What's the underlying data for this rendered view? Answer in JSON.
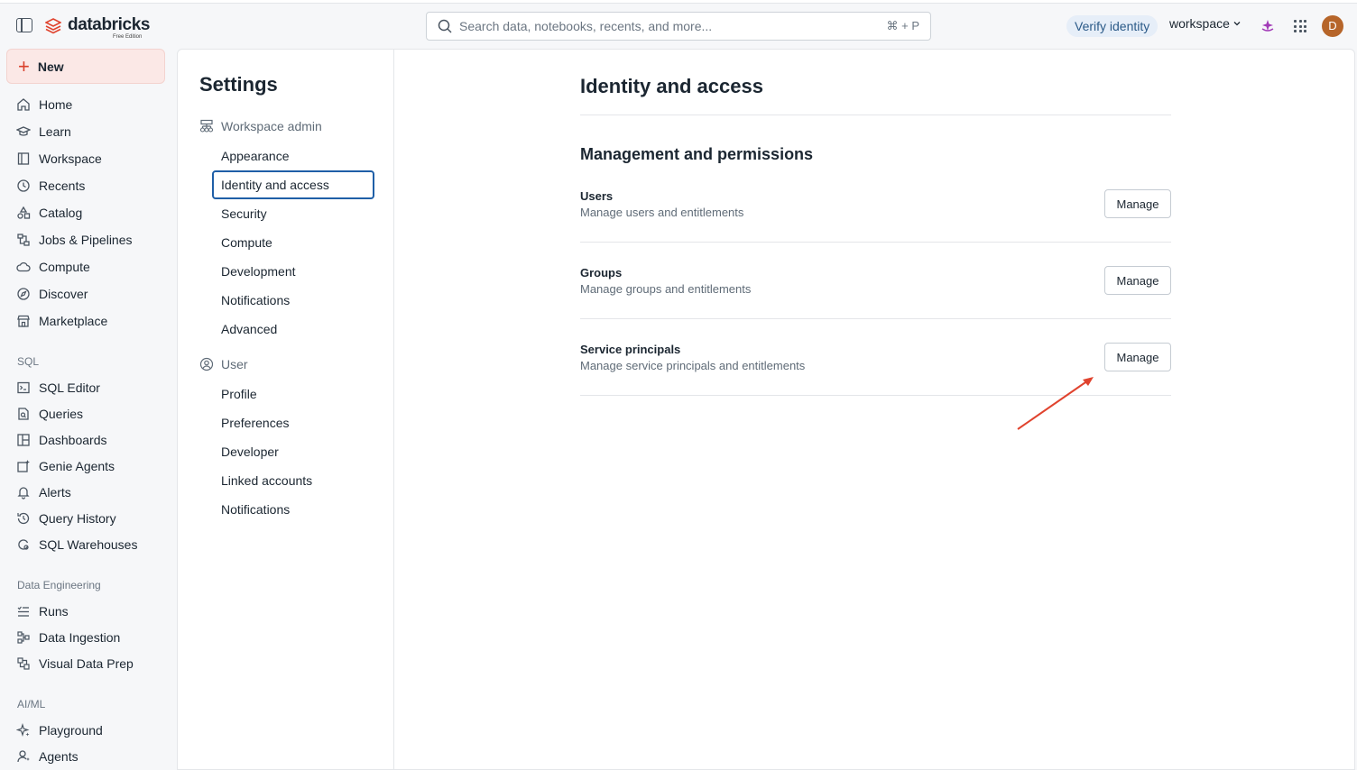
{
  "brand": {
    "name": "databricks",
    "edition": "Free Edition"
  },
  "search": {
    "placeholder": "Search data, notebooks, recents, and more...",
    "shortcut": "⌘ + P"
  },
  "header": {
    "verify_label": "Verify identity",
    "workspace_label": "workspace",
    "avatar_initial": "D"
  },
  "colors": {
    "accent": "#d9402b",
    "active_border": "#1f5fa7",
    "annotation_arrow": "#e0432e"
  },
  "sidebar": {
    "new_label": "New",
    "items": [
      {
        "label": "Home",
        "icon": "home-icon"
      },
      {
        "label": "Learn",
        "icon": "graduation-cap-icon"
      },
      {
        "label": "Workspace",
        "icon": "workspace-icon"
      },
      {
        "label": "Recents",
        "icon": "clock-icon"
      },
      {
        "label": "Catalog",
        "icon": "catalog-icon"
      },
      {
        "label": "Jobs & Pipelines",
        "icon": "workflows-icon"
      },
      {
        "label": "Compute",
        "icon": "cloud-icon"
      },
      {
        "label": "Discover",
        "icon": "compass-icon"
      },
      {
        "label": "Marketplace",
        "icon": "store-icon"
      }
    ],
    "sql_section": "SQL",
    "sql_items": [
      {
        "label": "SQL Editor",
        "icon": "sql-editor-icon"
      },
      {
        "label": "Queries",
        "icon": "query-icon"
      },
      {
        "label": "Dashboards",
        "icon": "dashboard-icon"
      },
      {
        "label": "Genie Agents",
        "icon": "genie-icon"
      },
      {
        "label": "Alerts",
        "icon": "bell-icon"
      },
      {
        "label": "Query History",
        "icon": "history-icon"
      },
      {
        "label": "SQL Warehouses",
        "icon": "warehouse-icon"
      }
    ],
    "de_section": "Data Engineering",
    "de_items": [
      {
        "label": "Runs",
        "icon": "runs-icon"
      },
      {
        "label": "Data Ingestion",
        "icon": "ingestion-icon"
      },
      {
        "label": "Visual Data Prep",
        "icon": "data-prep-icon"
      }
    ],
    "ai_section": "AI/ML",
    "ai_items": [
      {
        "label": "Playground",
        "icon": "sparkle-icon"
      },
      {
        "label": "Agents",
        "icon": "agent-icon"
      }
    ]
  },
  "settings": {
    "title": "Settings",
    "workspace_admin_label": "Workspace admin",
    "admin_items": [
      "Appearance",
      "Identity and access",
      "Security",
      "Compute",
      "Development",
      "Notifications",
      "Advanced"
    ],
    "active_item": "Identity and access",
    "user_label": "User",
    "user_items": [
      "Profile",
      "Preferences",
      "Developer",
      "Linked accounts",
      "Notifications"
    ]
  },
  "main": {
    "page_title": "Identity and access",
    "section_title": "Management and permissions",
    "rows": [
      {
        "name": "Users",
        "desc": "Manage users and entitlements",
        "button": "Manage"
      },
      {
        "name": "Groups",
        "desc": "Manage groups and entitlements",
        "button": "Manage"
      },
      {
        "name": "Service principals",
        "desc": "Manage service principals and entitlements",
        "button": "Manage"
      }
    ]
  }
}
